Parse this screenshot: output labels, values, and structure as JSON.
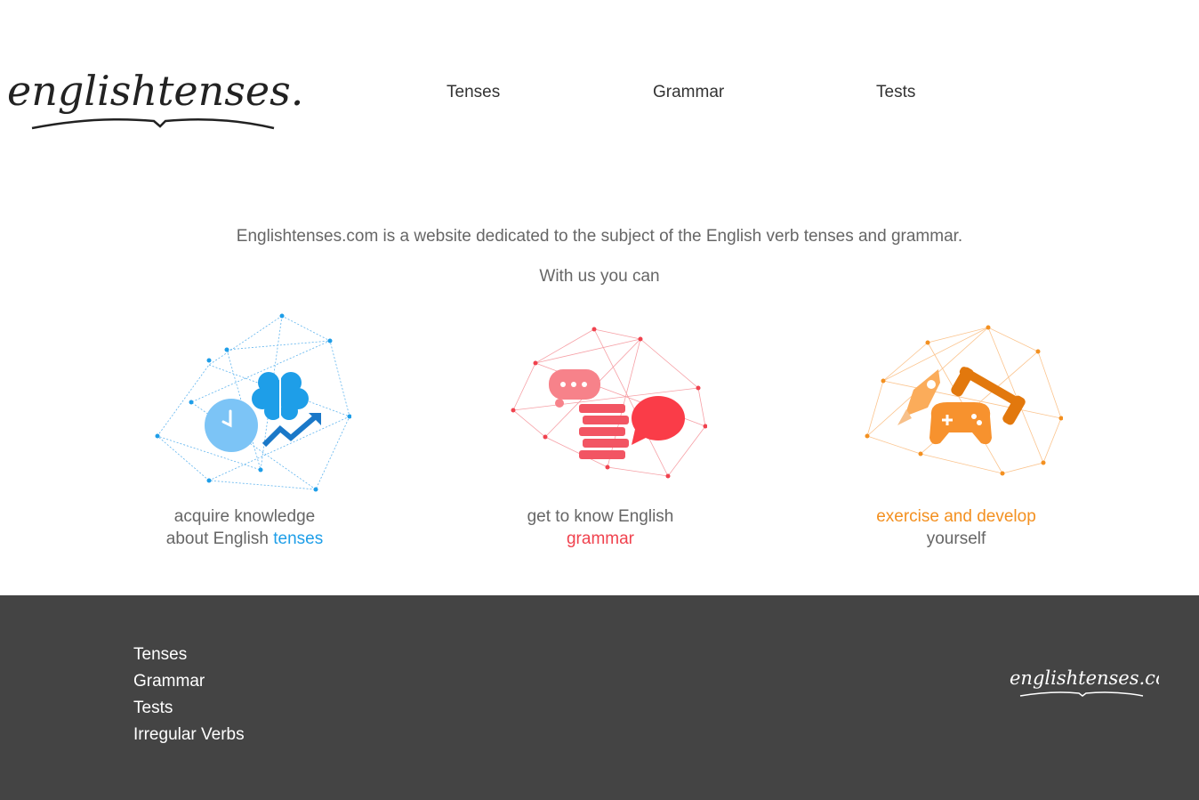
{
  "header": {
    "logo_text": "englishtenses.com",
    "nav": [
      {
        "label": "Tenses"
      },
      {
        "label": "Grammar"
      },
      {
        "label": "Tests"
      }
    ]
  },
  "intro": {
    "line1": "Englishtenses.com is a website dedicated to the subject of the English verb tenses and grammar.",
    "line2": "With us you can"
  },
  "features": [
    {
      "icon": "brain-clock-growth-icon",
      "caption_line1": "acquire knowledge",
      "caption_line2_prefix": "about English ",
      "caption_highlight": "tenses",
      "accent": "#1e9ee8"
    },
    {
      "icon": "books-speech-bubbles-icon",
      "caption_line1": "get to know English",
      "caption_line2_prefix": "",
      "caption_highlight": "grammar",
      "accent": "#f0424e"
    },
    {
      "icon": "rocket-dumbbell-gamepad-icon",
      "caption_highlight": "exercise and develop",
      "caption_line2": "yourself",
      "accent": "#f39020"
    }
  ],
  "footer": {
    "links": [
      {
        "label": "Tenses"
      },
      {
        "label": "Grammar"
      },
      {
        "label": "Tests"
      },
      {
        "label": "Irregular Verbs"
      }
    ],
    "logo_text": "englishtenses.com"
  },
  "colors": {
    "footer_bg": "#444444",
    "text": "#666666",
    "blue": "#1e9ee8",
    "red": "#f0424e",
    "orange": "#f39020"
  }
}
